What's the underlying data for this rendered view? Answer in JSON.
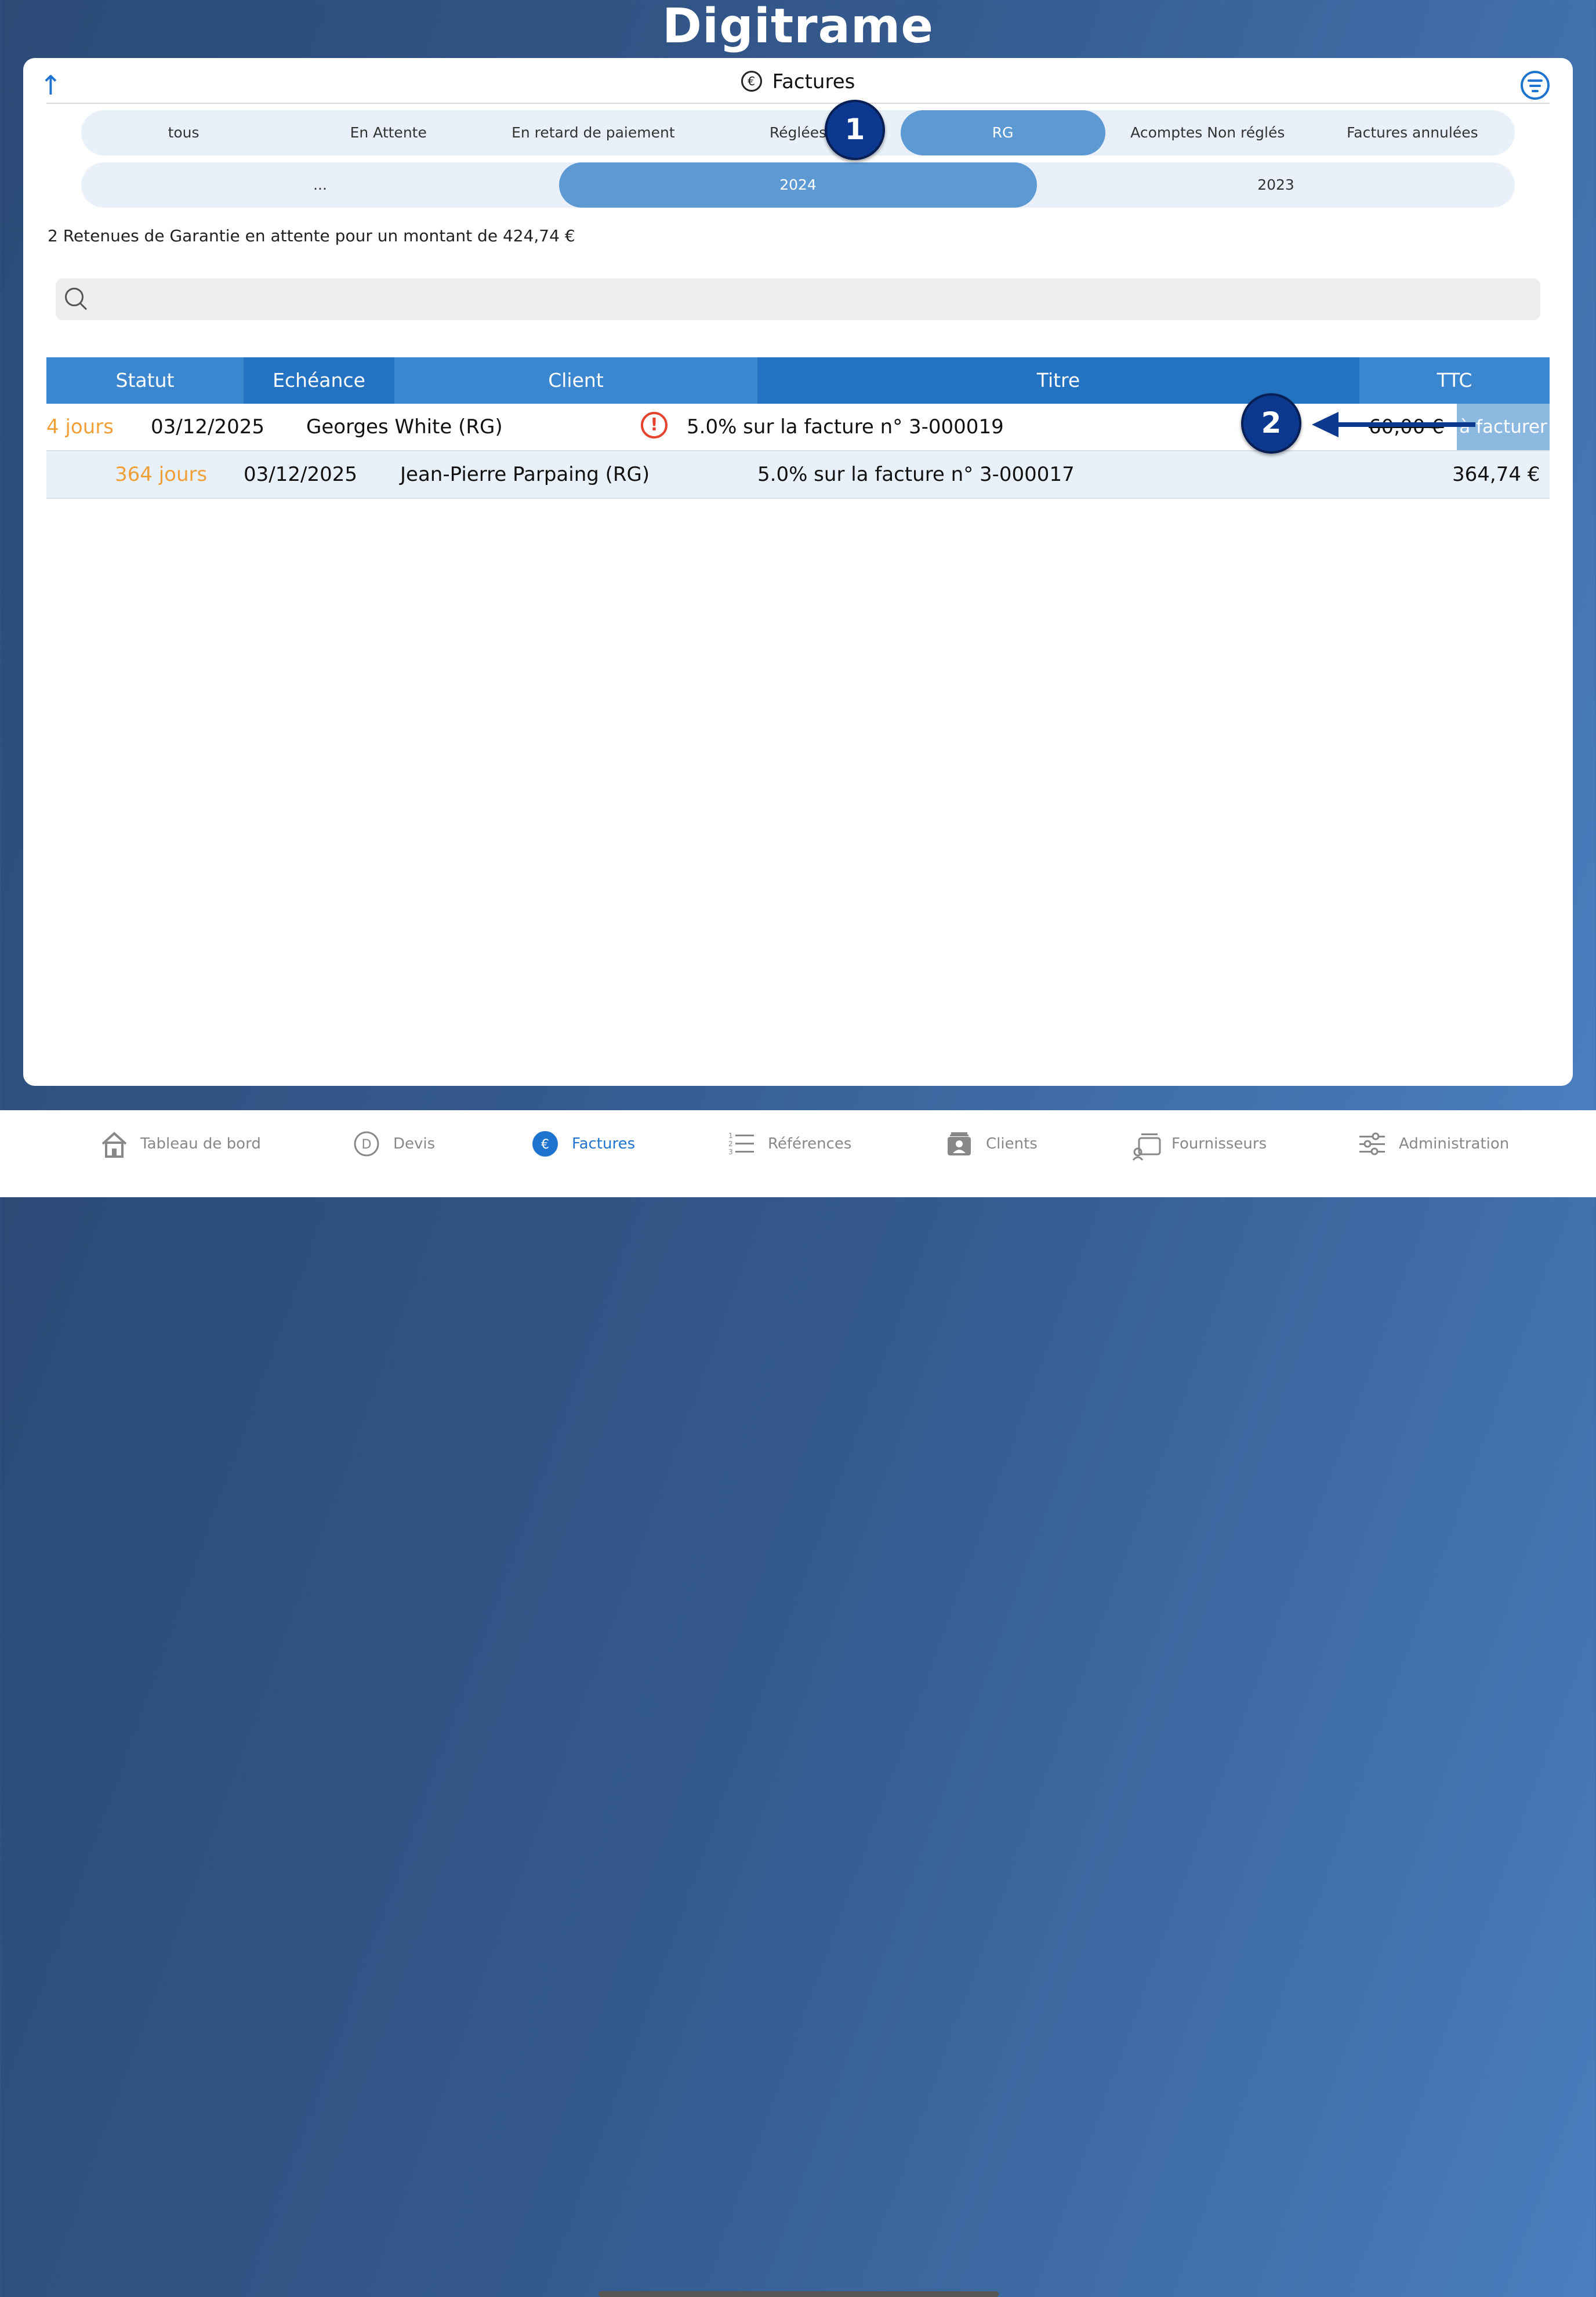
{
  "app": {
    "logo": "Digitrame"
  },
  "header": {
    "title": "Factures"
  },
  "status_tabs": [
    {
      "label": "tous",
      "active": false
    },
    {
      "label": "En Attente",
      "active": false
    },
    {
      "label": "En retard de paiement",
      "active": false
    },
    {
      "label": "Réglées",
      "active": false
    },
    {
      "label": "RG",
      "active": true
    },
    {
      "label": "Acomptes Non réglés",
      "active": false
    },
    {
      "label": "Factures annulées",
      "active": false
    }
  ],
  "year_tabs": [
    {
      "label": "...",
      "active": false
    },
    {
      "label": "2024",
      "active": true
    },
    {
      "label": "2023",
      "active": false
    }
  ],
  "summary": "2 Retenues de Garantie en attente pour un montant de 424,74 €",
  "search": {
    "placeholder": ""
  },
  "table": {
    "columns": [
      "Statut",
      "Echéance",
      "Client",
      "Titre",
      "TTC"
    ],
    "rows": [
      {
        "statut": "4 jours",
        "echeance": "03/12/2025",
        "client": "Georges White (RG)",
        "titre": "5.0% sur la facture n° 3-000019",
        "ttc": "60,00 €",
        "action": "à facturer"
      },
      {
        "statut": "364 jours",
        "echeance": "03/12/2025",
        "client": "Jean-Pierre Parpaing (RG)",
        "titre": "5.0% sur la facture n° 3-000017",
        "ttc": "364,74 €"
      }
    ]
  },
  "annotations": {
    "marker1": "1",
    "marker2": "2"
  },
  "tabbar": [
    {
      "label": "Tableau de bord",
      "icon": "home-icon"
    },
    {
      "label": "Devis",
      "icon": "devis-icon"
    },
    {
      "label": "Factures",
      "icon": "euro-icon",
      "active": true
    },
    {
      "label": "Références",
      "icon": "list-icon"
    },
    {
      "label": "Clients",
      "icon": "clients-icon"
    },
    {
      "label": "Fournisseurs",
      "icon": "suppliers-icon"
    },
    {
      "label": "Administration",
      "icon": "sliders-icon"
    }
  ],
  "colors": {
    "accent": "#1e74cf",
    "active_tab": "#5d9ad4",
    "orange": "#f0a037",
    "warning": "#e5432e",
    "marker": "#0d3890"
  }
}
